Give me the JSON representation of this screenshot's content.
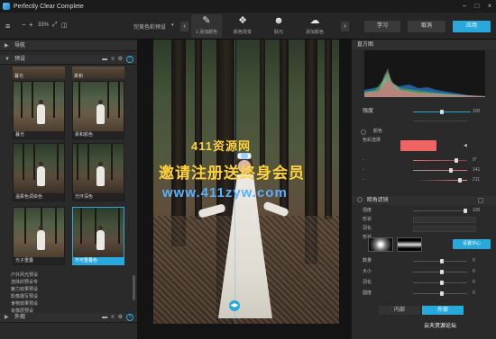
{
  "window": {
    "title": "Perfectly Clear Complete"
  },
  "toolbar": {
    "zoom_minus": "−",
    "zoom_plus": "+",
    "zoom_value": "33%",
    "preset_label": "完美色彩预设",
    "tools": [
      {
        "icon": "brush-icon",
        "glyph": "✎",
        "label": "1 添加颜色"
      },
      {
        "icon": "paint-icon",
        "glyph": "❖",
        "label": "颜色改变"
      },
      {
        "icon": "people-icon",
        "glyph": "☻",
        "label": "肤元"
      },
      {
        "icon": "cloud-icon",
        "glyph": "☁",
        "label": "添加颜色"
      }
    ],
    "learn_label": "学习",
    "cancel_label": "取消",
    "apply_label": "应用"
  },
  "left_panel": {
    "nav_header": "导航",
    "presets_header": "预设",
    "top_captions": [
      "暮光",
      "柔和"
    ],
    "thumbs": [
      {
        "label": "暮光"
      },
      {
        "label": "柔和颜色"
      },
      {
        "label": "温柔色调染色"
      },
      {
        "label": "光环深色"
      },
      {
        "label": "光子重叠"
      },
      {
        "label": "不可重叠色"
      }
    ],
    "list_items": [
      "户外风光预设",
      "流体的预设专",
      "魅力效果预设",
      "影像摄写预设",
      "食物效果预设",
      "肖像层预设"
    ],
    "footer_header": "外观"
  },
  "right_panel": {
    "histogram_title": "直方图",
    "strength_label": "强度",
    "strength_value": "100",
    "color_section": {
      "fields": [
        {
          "label": "颜色",
          "value": ""
        },
        {
          "label": "色彩选择",
          "value": ""
        }
      ],
      "swatch_color": "#f06464",
      "sliders": [
        {
          "value": "0°"
        },
        {
          "value": "141"
        },
        {
          "value": "211"
        }
      ]
    },
    "vignette_header": "暗角滤镜",
    "vignette_rows": [
      {
        "label": "强度",
        "value": "100"
      },
      {
        "label": "形状",
        "value": "0"
      },
      {
        "label": "羽化",
        "value": "0"
      }
    ],
    "vignette_shape_label": "形状",
    "vignette_center_btn": "设置中心",
    "vignette_sliders": [
      {
        "label": "数量",
        "value": "0"
      },
      {
        "label": "大小",
        "value": "0"
      },
      {
        "label": "羽化",
        "value": "0"
      },
      {
        "label": "圆度",
        "value": "0"
      }
    ],
    "inside_label": "内部",
    "outside_label": "外部",
    "footer_brand": "云天资源论坛"
  },
  "watermark": {
    "line1": "411资源网",
    "line2": "邀请注册送终身会员",
    "line3": "www.411zyw.com"
  },
  "colors": {
    "accent": "#29a8dc",
    "swatch": "#f06464"
  }
}
